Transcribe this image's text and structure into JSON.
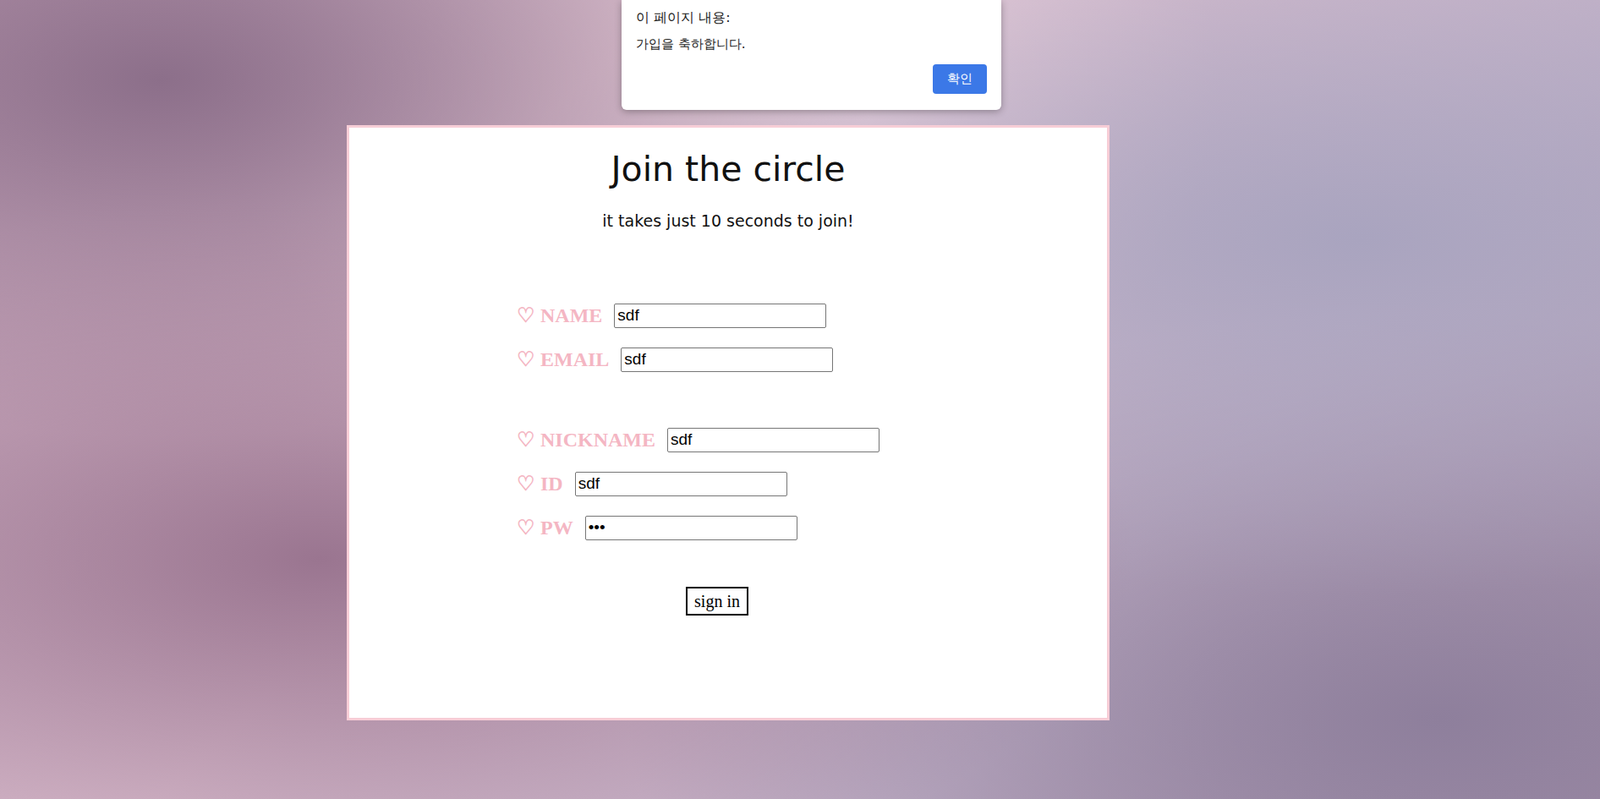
{
  "dialog": {
    "header": "이 페이지 내용:",
    "message": "가입을 축하합니다.",
    "button": "확인"
  },
  "form": {
    "title": "Join the circle",
    "subtitle": "it takes just 10 seconds to join!",
    "groups": [
      [
        {
          "icon": "♡",
          "label": "NAME",
          "value": "sdf"
        },
        {
          "icon": "♡",
          "label": "EMAIL",
          "value": "sdf"
        }
      ],
      [
        {
          "icon": "♡",
          "label": "NICKNAME",
          "value": "sdf"
        },
        {
          "icon": "♡",
          "label": "ID",
          "value": "sdf"
        },
        {
          "icon": "♡",
          "label": "PW",
          "value": "•••"
        }
      ]
    ],
    "submit": "sign in"
  }
}
